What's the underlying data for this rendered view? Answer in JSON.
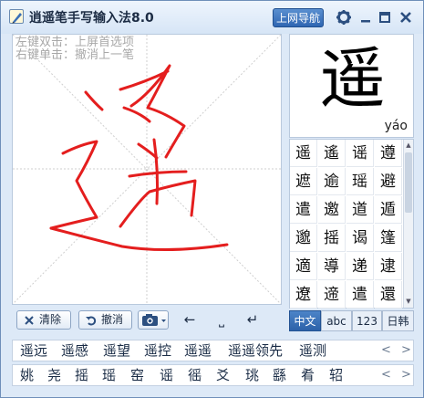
{
  "app": {
    "title": "逍遥笔手写输入法8.0",
    "nav_button": "上网导航"
  },
  "canvas": {
    "hint_left_double": "左键双击：上屏首选项",
    "hint_right_click": "右键单击：撤消上一笔",
    "ink_color": "#e41e1e"
  },
  "recognized": {
    "char": "遥",
    "pinyin": "yáo"
  },
  "candidates_grid": [
    [
      "遥",
      "遙",
      "谣",
      "遵"
    ],
    [
      "遮",
      "逾",
      "瑶",
      "避"
    ],
    [
      "遣",
      "邀",
      "道",
      "遁"
    ],
    [
      "邈",
      "摇",
      "谒",
      "篷"
    ],
    [
      "適",
      "導",
      "递",
      "逮"
    ],
    [
      "遼",
      "遆",
      "遣",
      "還"
    ]
  ],
  "toolbar": {
    "clear": "清除",
    "undo": "撤消",
    "left_arrow": "←",
    "space": "⎵",
    "enter": "↵"
  },
  "modes": [
    "中文",
    "abc",
    "123",
    "日韩"
  ],
  "words_bar": [
    "遥远",
    "遥感",
    "遥望",
    "遥控",
    "遥遥",
    "遥遥领先",
    "遥测"
  ],
  "chars_bar": [
    "姚",
    "尧",
    "摇",
    "瑶",
    "窑",
    "谣",
    "徭",
    "爻",
    "珧",
    "繇",
    "肴",
    "轺"
  ],
  "colors": {
    "accent": "#2f66b2",
    "window_bg": "#dde9f7"
  }
}
